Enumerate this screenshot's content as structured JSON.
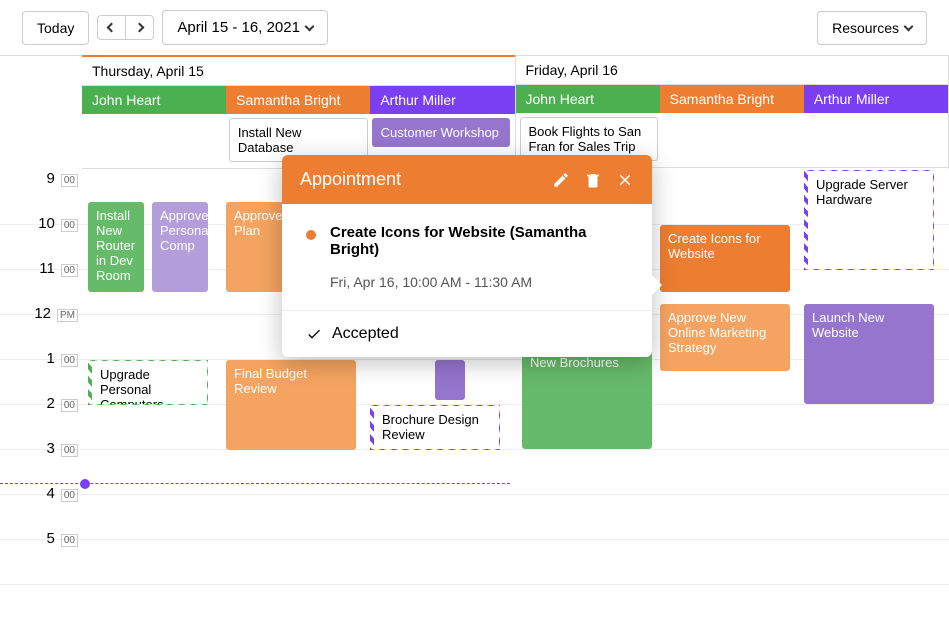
{
  "toolbar": {
    "today": "Today",
    "date_range": "April 15 - 16, 2021",
    "resources": "Resources"
  },
  "days": [
    {
      "label": "Thursday, April 15",
      "active": true
    },
    {
      "label": "Friday, April 16",
      "active": false
    }
  ],
  "owners": [
    "John Heart",
    "Samantha Bright",
    "Arthur Miller"
  ],
  "allday_day1": {
    "col2": "Install New Database",
    "col3": "Customer Workshop"
  },
  "allday_day2": {
    "col1": "Book Flights to San Fran for Sales Trip"
  },
  "time_labels": [
    "9",
    "10",
    "11",
    "12",
    "1",
    "2",
    "3",
    "4",
    "5"
  ],
  "time_ampm": [
    "00",
    "00",
    "00",
    "PM",
    "00",
    "00",
    "00",
    "00",
    "00"
  ],
  "events": {
    "d1_install_router": "Install New Router in Dev Room",
    "d1_approve_personal": "Approve Personal Comp",
    "d1_approve_comp_plan": "Approve Computer Plan",
    "d1_upgrade_pc": "Upgrade Personal Computers",
    "d1_final_budget": "Final Budget Review",
    "d1_brochure_review": "Brochure Design Review",
    "d2_create_icons": "Create Icons for Website",
    "d2_approve_marketing": "Approve New Online Marketing Strategy",
    "d2_new_brochures": "New Brochures",
    "d2_upgrade_server": "Upgrade Server Hardware",
    "d2_launch_website": "Launch New Website"
  },
  "popup": {
    "header": "Appointment",
    "title": "Create Icons for Website (Samantha Bright)",
    "time": "Fri, Apr 16, 10:00 AM - 11:30 AM",
    "status": "Accepted"
  },
  "chart_data": {
    "type": "table",
    "view": "2-day timeline",
    "date_range": [
      "2021-04-15",
      "2021-04-16"
    ],
    "resources": [
      "John Heart",
      "Samantha Bright",
      "Arthur Miller"
    ],
    "current_time_indicator": "≈3:45 PM (Apr 15)",
    "all_day_events": [
      {
        "date": "2021-04-15",
        "resource": "Samantha Bright",
        "title": "Install New Database"
      },
      {
        "date": "2021-04-15",
        "resource": "Arthur Miller",
        "title": "Customer Workshop"
      },
      {
        "date": "2021-04-16",
        "resource": "John Heart",
        "title": "Book Flights to San Fran for Sales Trip"
      }
    ],
    "timed_events": [
      {
        "date": "2021-04-15",
        "resource": "John Heart",
        "title": "Install New Router in Dev Room",
        "start": "9:30",
        "end": "11:30"
      },
      {
        "date": "2021-04-15",
        "resource": "John Heart",
        "title": "Approve Personal Comp",
        "start": "9:30",
        "end": "11:30"
      },
      {
        "date": "2021-04-15",
        "resource": "John Heart",
        "title": "Upgrade Personal Computers",
        "start": "1:00",
        "end": "2:00"
      },
      {
        "date": "2021-04-15",
        "resource": "Samantha Bright",
        "title": "Approve Computer Plan",
        "start": "9:30",
        "end": "11:30"
      },
      {
        "date": "2021-04-15",
        "resource": "Samantha Bright",
        "title": "Final Budget Review",
        "start": "1:00",
        "end": "3:00"
      },
      {
        "date": "2021-04-15",
        "resource": "Arthur Miller",
        "title": "(untitled purple block)",
        "start": "1:00",
        "end": "2:00"
      },
      {
        "date": "2021-04-15",
        "resource": "Arthur Miller",
        "title": "Brochure Design Review",
        "start": "2:00",
        "end": "3:00"
      },
      {
        "date": "2021-04-16",
        "resource": "John Heart",
        "title": "New Brochures",
        "start": "12:45",
        "end": "3:00"
      },
      {
        "date": "2021-04-16",
        "resource": "Samantha Bright",
        "title": "Create Icons for Website",
        "start": "10:00",
        "end": "11:30",
        "selected": true
      },
      {
        "date": "2021-04-16",
        "resource": "Samantha Bright",
        "title": "Approve New Online Marketing Strategy",
        "start": "11:45",
        "end": "1:15"
      },
      {
        "date": "2021-04-16",
        "resource": "Arthur Miller",
        "title": "Upgrade Server Hardware",
        "start": "8:45",
        "end": "11:00"
      },
      {
        "date": "2021-04-16",
        "resource": "Arthur Miller",
        "title": "Launch New Website",
        "start": "11:45",
        "end": "2:00"
      }
    ]
  }
}
